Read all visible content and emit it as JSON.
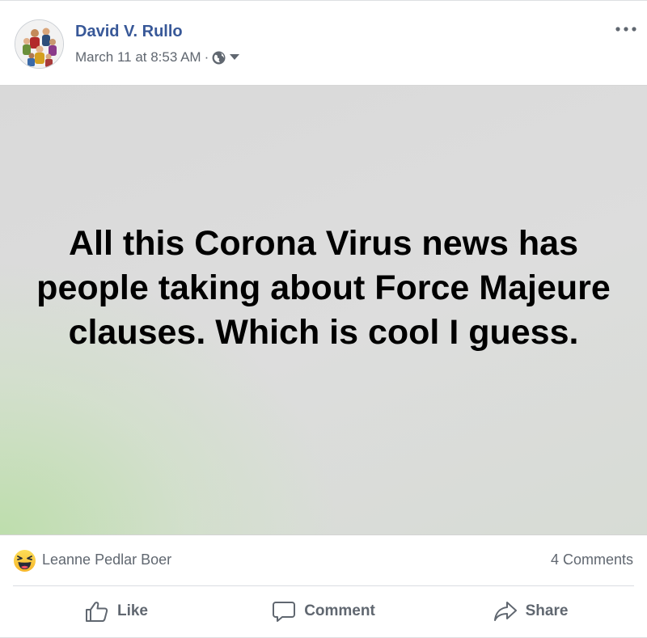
{
  "post": {
    "author": "David V. Rullo",
    "timestamp": "March 11 at 8:53 AM",
    "separator": "·",
    "privacy_icon": "globe-icon",
    "audience_dropdown_icon": "caret-down-icon",
    "options_icon": "more-options-icon",
    "avatar_icon": "profile-photo",
    "body_text": "All this Corona Virus news has people taking about Force Majeure clauses. Which is cool I guess.",
    "background_colors": {
      "base": "#dddddd",
      "accent": "#bcdeaa"
    }
  },
  "reactions": {
    "emoji_icon": "haha-reaction-icon",
    "reactor_name": "Leanne Pedlar Boer",
    "comments_label": "4 Comments"
  },
  "actions": {
    "like_label": "Like",
    "comment_label": "Comment",
    "share_label": "Share"
  },
  "colors": {
    "author_link": "#385898",
    "secondary_text": "#606770",
    "divider": "#dadde1"
  }
}
